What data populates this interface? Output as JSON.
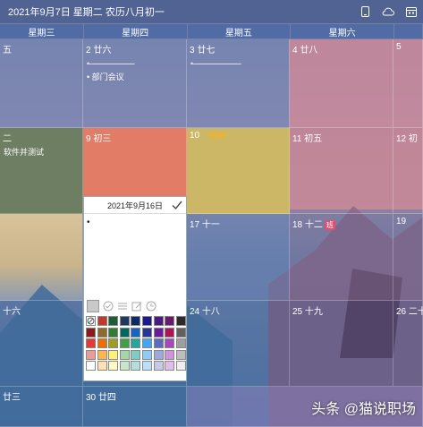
{
  "titlebar": {
    "title": "2021年9月7日 星期二 农历八月初一",
    "icons": [
      "phone-icon",
      "cloud-icon",
      "calendar-icon"
    ]
  },
  "weekdays": [
    "星期三",
    "星期四",
    "星期五",
    "星期六",
    ""
  ],
  "rows": [
    {
      "cells": [
        {
          "day": "",
          "lunar": "五",
          "events": [
            {
              "text": "",
              "done": true
            }
          ]
        },
        {
          "day": "2",
          "lunar": "廿六",
          "events": [
            {
              "text": "",
              "done": true
            },
            {
              "text": "部门会议",
              "done": false
            }
          ]
        },
        {
          "day": "3",
          "lunar": "廿七",
          "events": [
            {
              "text": "",
              "done": true
            }
          ]
        },
        {
          "day": "4",
          "lunar": "廿八",
          "events": []
        },
        {
          "day": "5",
          "lunar": "",
          "events": []
        }
      ]
    },
    {
      "cells": [
        {
          "day": "",
          "lunar": "二",
          "events": [
            {
              "text": "软件并测试",
              "done": false
            }
          ]
        },
        {
          "day": "9",
          "lunar": "初三",
          "events": []
        },
        {
          "day": "10",
          "lunar": "",
          "events": []
        },
        {
          "day": "11",
          "lunar": "初五",
          "events": []
        },
        {
          "day": "12",
          "lunar": "初",
          "events": []
        }
      ]
    },
    {
      "cells": [
        {
          "day": "",
          "lunar": "",
          "events": []
        },
        {
          "day": "",
          "lunar": "",
          "events": []
        },
        {
          "day": "17",
          "lunar": "十一",
          "events": []
        },
        {
          "day": "18",
          "lunar": "十二",
          "badge": "班",
          "events": []
        },
        {
          "day": "19",
          "lunar": "",
          "events": []
        }
      ]
    },
    {
      "cells": [
        {
          "day": "",
          "lunar": "十六",
          "events": []
        },
        {
          "day": "",
          "lunar": "",
          "events": []
        },
        {
          "day": "24",
          "lunar": "十八",
          "events": []
        },
        {
          "day": "25",
          "lunar": "十九",
          "events": []
        },
        {
          "day": "26",
          "lunar": "二十",
          "events": []
        }
      ]
    },
    {
      "cells": [
        {
          "day": "",
          "lunar": "廿三",
          "events": []
        },
        {
          "day": "30",
          "lunar": "廿四",
          "events": []
        },
        {
          "day": "",
          "lunar": "",
          "events": []
        },
        {
          "day": "",
          "lunar": "",
          "events": []
        },
        {
          "day": "",
          "lunar": "",
          "events": []
        }
      ]
    }
  ],
  "popup": {
    "date": "2021年9月16日",
    "editor_text": "•",
    "tools": [
      "no-color-icon",
      "check-circle-icon",
      "list-icon",
      "edit-icon",
      "clock-icon"
    ],
    "colors": [
      "none",
      "#c0392b",
      "#1f5d3a",
      "#1e3a5f",
      "#0e2a66",
      "#1a1a8c",
      "#4b1a80",
      "#6b1a6b",
      "#2b2b2b",
      "#8b1a1a",
      "#8a6d2a",
      "#2e7d32",
      "#00695c",
      "#1565c0",
      "#283593",
      "#6a1b9a",
      "#ad1457",
      "#616161",
      "#e53935",
      "#ef6c00",
      "#9e9d24",
      "#43a047",
      "#26a69a",
      "#42a5f5",
      "#5c6bc0",
      "#ab47bc",
      "#9e9e9e",
      "#ef9a9a",
      "#ffb74d",
      "#fff176",
      "#a5d6a7",
      "#80cbc4",
      "#90caf9",
      "#9fa8da",
      "#ce93d8",
      "#bdbdbd",
      "#ffffff",
      "#ffe0b2",
      "#fff9c4",
      "#c8e6c9",
      "#b2dfdb",
      "#bbdefb",
      "#c5cae9",
      "#e1bee7",
      "#eeeeee"
    ]
  },
  "watermark": "头条 @猫说职场"
}
